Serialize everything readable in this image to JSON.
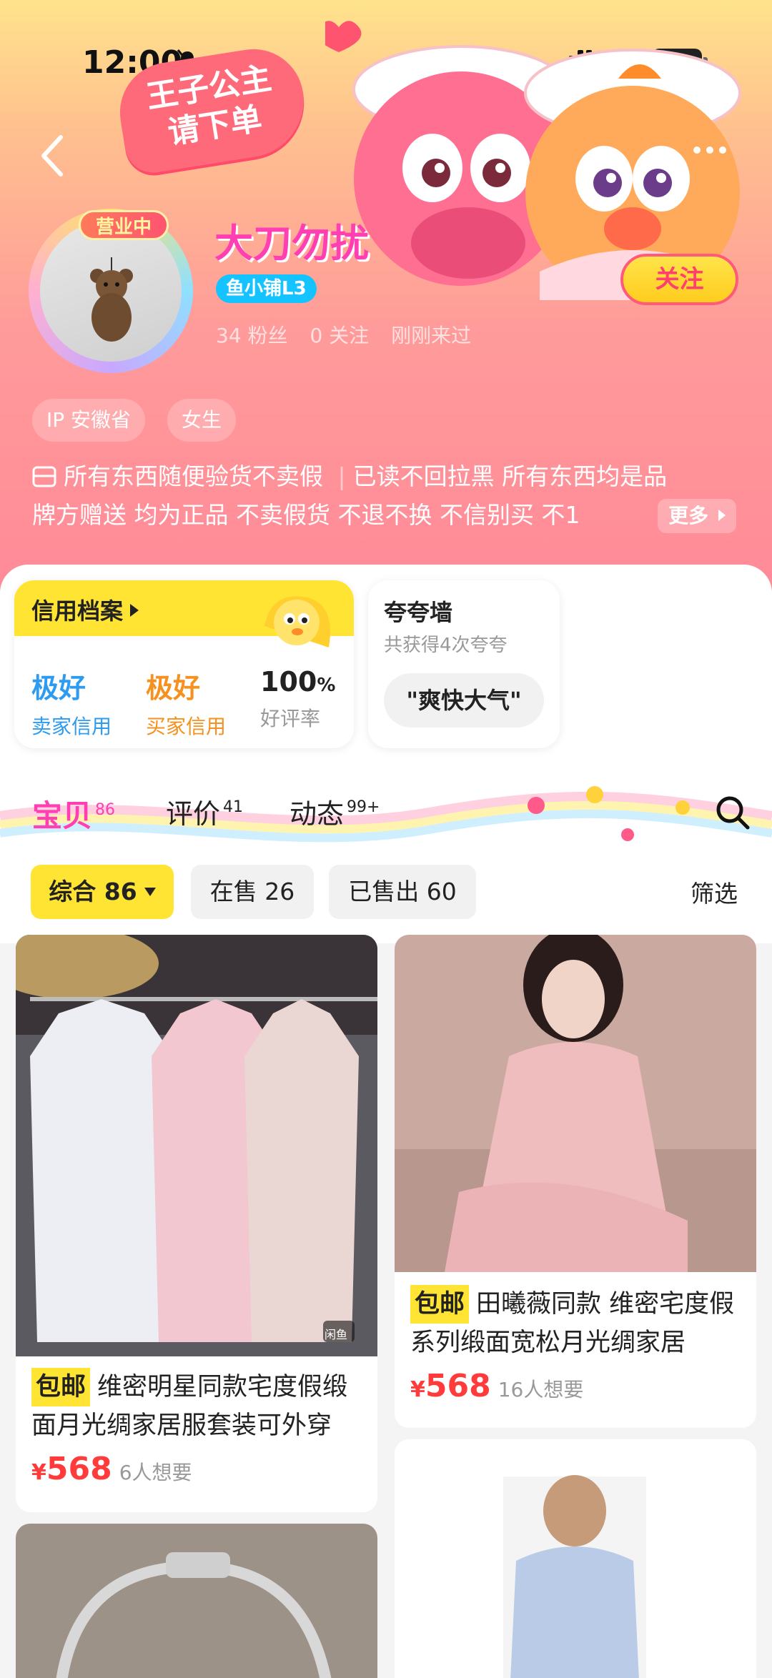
{
  "status_bar": {
    "time": "12:00",
    "network": "5G",
    "battery": "53"
  },
  "header": {
    "promo_line1": "王子公主",
    "promo_line2": "请下单",
    "open_badge": "营业中",
    "shop_name": "大刀勿扰",
    "level_badge": "鱼小铺L3",
    "follow_label": "关注",
    "stats": {
      "fans": "34 粉丝",
      "following": "0 关注",
      "last_seen": "刚刚来过"
    },
    "tags": [
      "IP 安徽省",
      "女生"
    ],
    "bio_line1_a": "所有东西随便验货不卖假",
    "bio_line1_b": "已读不回拉黑  所有东西均是品",
    "bio_line2": "牌方赠送  均为正品  不卖假货  不退不换  不信别买  不1",
    "more_label": "更多"
  },
  "credit": {
    "title": "信用档案",
    "items": [
      {
        "value": "极好",
        "label": "卖家信用",
        "color": "#2d9bf0"
      },
      {
        "value": "极好",
        "label": "买家信用",
        "color": "#f5911e"
      },
      {
        "value": "100",
        "unit": "%",
        "label": "好评率",
        "color": "#222222"
      }
    ]
  },
  "praise": {
    "title": "夸夸墙",
    "subtitle": "共获得4次夸夸",
    "chip": "\"爽快大气\""
  },
  "tabs": [
    {
      "label": "宝贝",
      "count": "86"
    },
    {
      "label": "评价",
      "count": "41"
    },
    {
      "label": "动态",
      "count": "99+"
    }
  ],
  "filters": {
    "chips": [
      "综合 86",
      "在售 26",
      "已售出 60"
    ],
    "filter_label": "筛选"
  },
  "products": [
    {
      "tag": "包邮",
      "title": "维密明星同款宅度假缎面月光绸家居服套装可外穿",
      "yen": "¥",
      "price": "568",
      "want": "6人想要"
    },
    {
      "tag": "包邮",
      "title": "田曦薇同款 维密宅度假系列缎面宽松月光绸家居",
      "yen": "¥",
      "price": "568",
      "want": "16人想要"
    }
  ],
  "watermark": "闲鱼"
}
